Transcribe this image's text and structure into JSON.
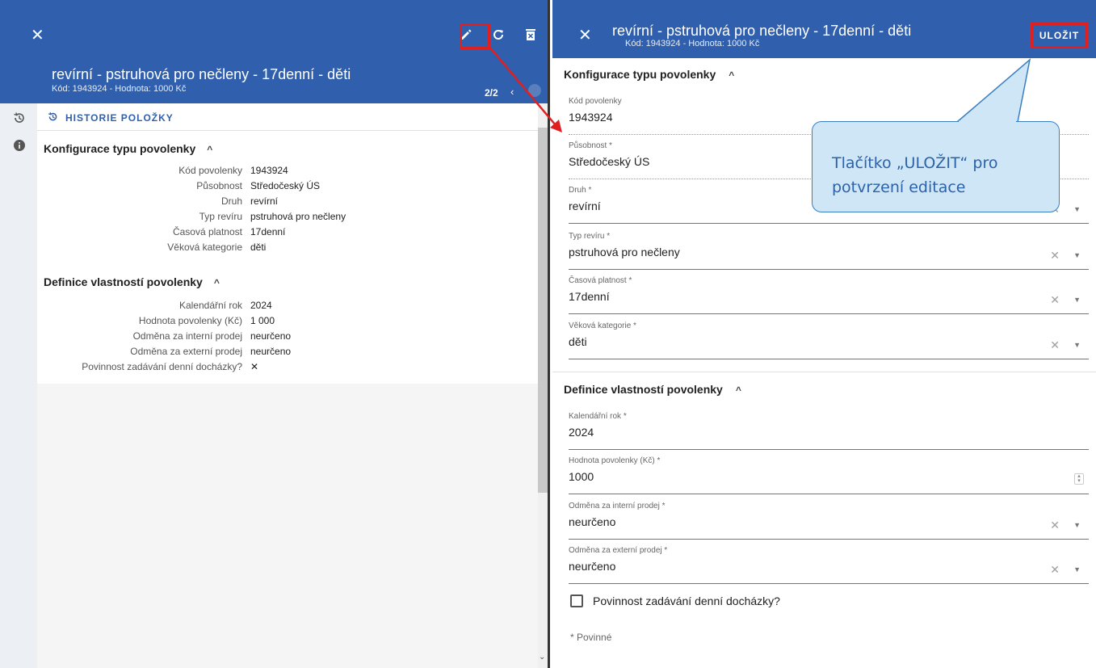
{
  "left": {
    "title": "revírní - pstruhová pro nečleny - 17denní - děti",
    "subtitle": "Kód: 1943924 - Hodnota: 1000 Kč",
    "pager": "2/2",
    "history_label": "HISTORIE POLOŽKY",
    "section1": {
      "title": "Konfigurace typu povolenky",
      "rows": [
        {
          "label": "Kód povolenky",
          "value": "1943924"
        },
        {
          "label": "Působnost",
          "value": "Středočeský ÚS"
        },
        {
          "label": "Druh",
          "value": "revírní"
        },
        {
          "label": "Typ revíru",
          "value": "pstruhová pro nečleny"
        },
        {
          "label": "Časová platnost",
          "value": "17denní"
        },
        {
          "label": "Věková kategorie",
          "value": "děti"
        }
      ]
    },
    "section2": {
      "title": "Definice vlastností povolenky",
      "rows": [
        {
          "label": "Kalendářní rok",
          "value": "2024"
        },
        {
          "label": "Hodnota povolenky (Kč)",
          "value": "1 000"
        },
        {
          "label": "Odměna za interní prodej",
          "value": "neurčeno"
        },
        {
          "label": "Odměna za externí prodej",
          "value": "neurčeno"
        },
        {
          "label": "Povinnost zadávání denní docházky?",
          "value": "✕"
        }
      ]
    }
  },
  "right": {
    "title": "revírní - pstruhová pro nečleny - 17denní - děti",
    "subtitle": "Kód: 1943924 - Hodnota: 1000 Kč",
    "save_label": "ULOŽIT",
    "section1": {
      "title": "Konfigurace typu povolenky",
      "fields": [
        {
          "label": "Kód povolenky",
          "value": "1943924"
        },
        {
          "label": "Působnost *",
          "value": "Středočeský ÚS"
        },
        {
          "label": "Druh *",
          "value": "revírní"
        },
        {
          "label": "Typ revíru *",
          "value": "pstruhová pro nečleny"
        },
        {
          "label": "Časová platnost *",
          "value": "17denní"
        },
        {
          "label": "Věková kategorie *",
          "value": "děti"
        }
      ]
    },
    "section2": {
      "title": "Definice vlastností povolenky",
      "fields": [
        {
          "label": "Kalendářní rok *",
          "value": "2024"
        },
        {
          "label": "Hodnota povolenky (Kč) *",
          "value": "1000"
        },
        {
          "label": "Odměna za interní prodej *",
          "value": "neurčeno"
        },
        {
          "label": "Odměna za externí prodej *",
          "value": "neurčeno"
        }
      ]
    },
    "checkbox_label": "Povinnost zadávání denní docházky?",
    "required_note": "* Povinné"
  },
  "callout": {
    "text": "Tlačítko „ULOŽIT“ pro potvrzení editace"
  },
  "colors": {
    "topbar": "#2f5fad",
    "highlight": "#e02020",
    "callout_bg": "#cfe6f6",
    "callout_text": "#2b62a8"
  },
  "icons": [
    "close-icon",
    "pencil-icon",
    "refresh-icon",
    "delete-icon",
    "history-icon",
    "info-icon",
    "chevron-up-icon",
    "clear-icon",
    "dropdown-icon"
  ]
}
